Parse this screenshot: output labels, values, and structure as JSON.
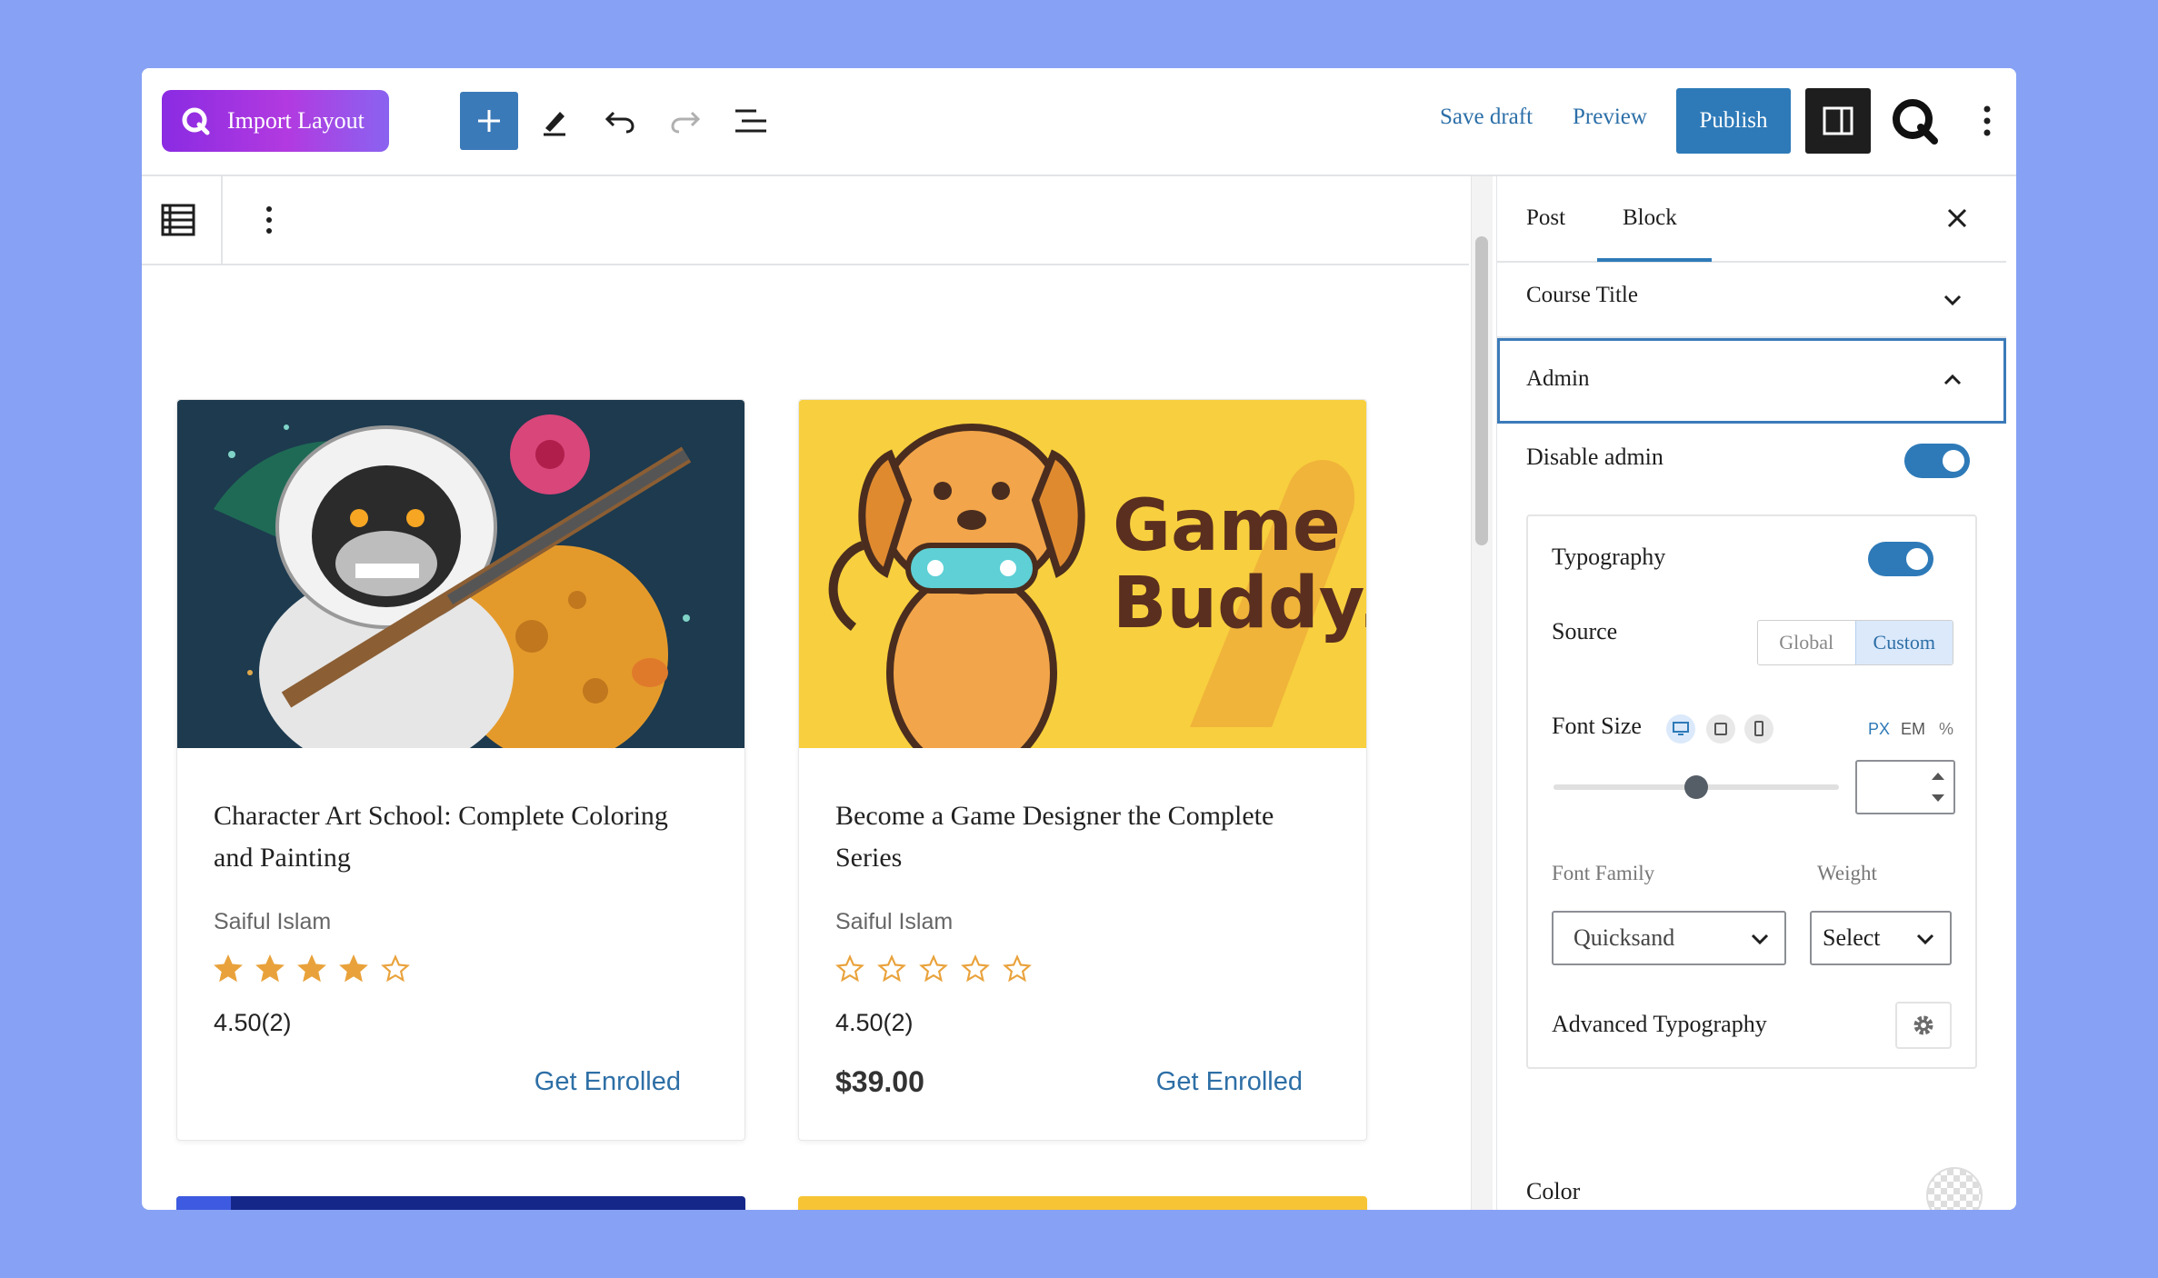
{
  "toolbar": {
    "import_label": "Import Layout",
    "save_draft": "Save draft",
    "preview": "Preview",
    "publish": "Publish"
  },
  "cards": [
    {
      "title": "Character Art School: Complete Coloring and Painting",
      "author": "Saiful Islam",
      "rating_text": "4.50(2)",
      "stars_filled": 4,
      "price": "",
      "cta": "Get Enrolled"
    },
    {
      "title": "Become a Game Designer the Complete Series",
      "author": "Saiful Islam",
      "rating_text": "4.50(2)",
      "stars_filled": 0,
      "price": "$39.00",
      "cta": "Get Enrolled",
      "thumb_text_1": "Game",
      "thumb_text_2": "Buddy."
    }
  ],
  "sidebar": {
    "tabs": [
      "Post",
      "Block"
    ],
    "active_tab": "Block",
    "course_title_panel": "Course Title",
    "admin_panel": "Admin",
    "disable_admin_label": "Disable admin",
    "disable_admin_on": true,
    "typography_label": "Typography",
    "typography_on": true,
    "source_label": "Source",
    "source_options": [
      "Global",
      "Custom"
    ],
    "source_selected": "Custom",
    "font_size_label": "Font Size",
    "units": [
      "PX",
      "EM",
      "%"
    ],
    "font_size_slider": 0.5,
    "font_size_value": "",
    "font_family_label": "Font Family",
    "font_family_value": "Quicksand",
    "weight_label": "Weight",
    "weight_value": "Select",
    "advanced_typography_label": "Advanced Typography",
    "color_label": "Color"
  },
  "colors": {
    "accent": "#2e7ab8",
    "background": "#87a1f5",
    "star": "#e9a23b",
    "link": "#2e6fa6"
  }
}
